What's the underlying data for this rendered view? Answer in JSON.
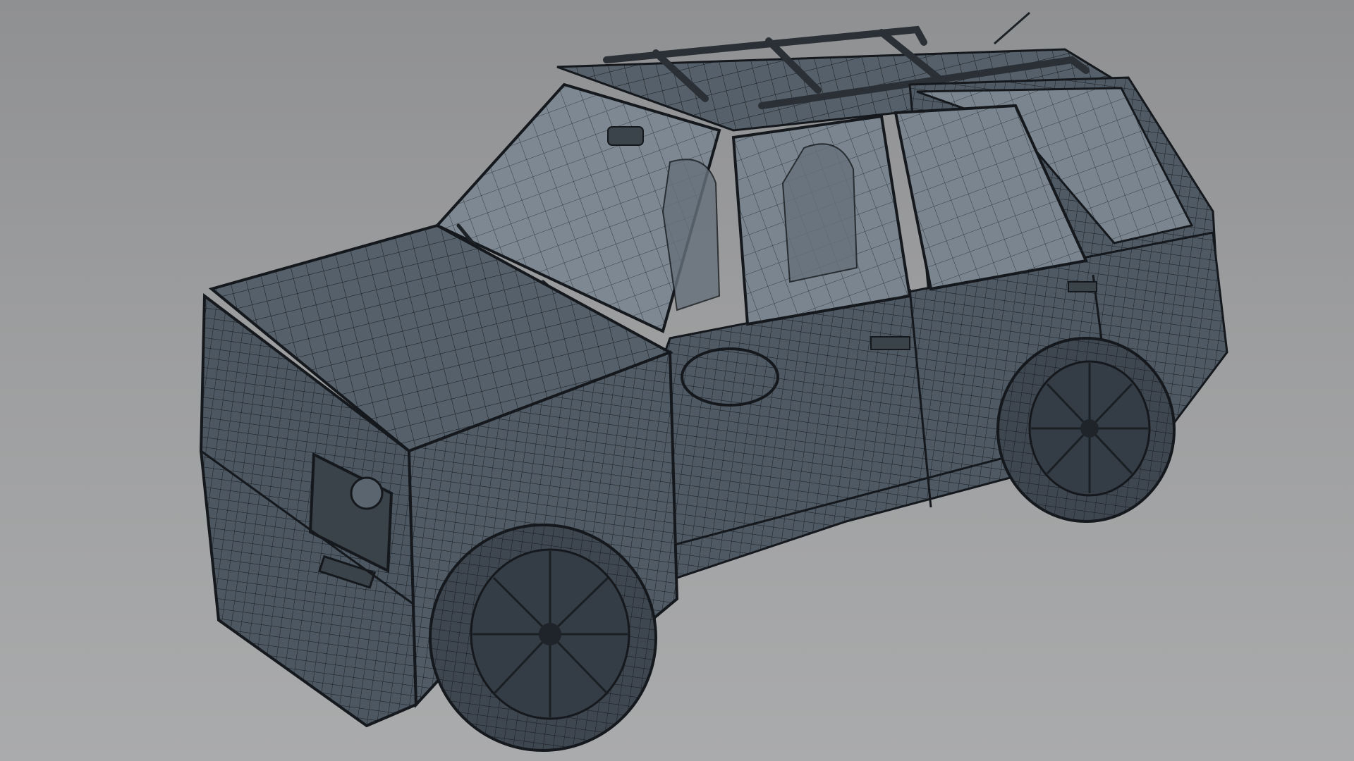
{
  "viewport": {
    "render_style": "wireframe-on-shaded",
    "background_gradient": [
      "#8f9092",
      "#aaabac"
    ]
  },
  "model": {
    "subject": "suv-car",
    "shading": {
      "body": "#4f5963",
      "body_highlight": "#5e6873",
      "glass": "#7a858f",
      "tire": "#3e4650",
      "wire": "#15191d"
    }
  }
}
